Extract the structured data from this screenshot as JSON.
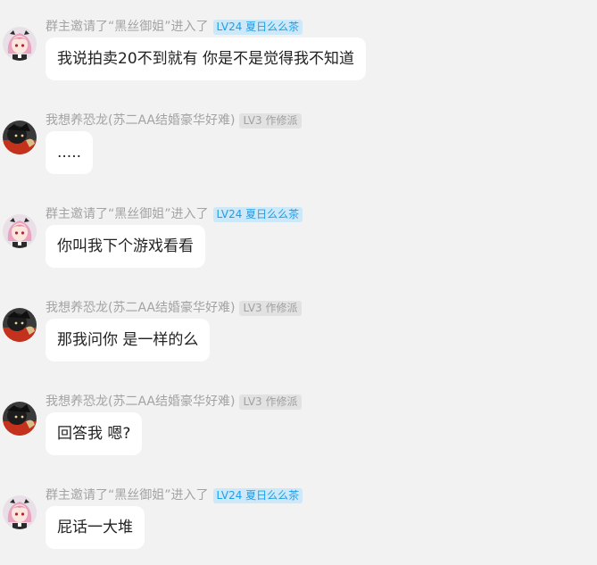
{
  "messages": [
    {
      "sender": "群主邀请了“黑丝御姐”进入了",
      "badge": "LV24 夏日么么茶",
      "badge_style": "blue",
      "avatar": "anime-girl-avatar",
      "text": "我说拍卖20不到就有 你是不是觉得我不知道"
    },
    {
      "sender": "我想养恐龙(苏二AA结婚豪华好难)",
      "badge": "LV3 作修派",
      "badge_style": "gray",
      "avatar": "dark-character-avatar",
      "text": "....."
    },
    {
      "sender": "群主邀请了“黑丝御姐”进入了",
      "badge": "LV24 夏日么么茶",
      "badge_style": "blue",
      "avatar": "anime-girl-avatar",
      "text": "你叫我下个游戏看看"
    },
    {
      "sender": "我想养恐龙(苏二AA结婚豪华好难)",
      "badge": "LV3 作修派",
      "badge_style": "gray",
      "avatar": "dark-character-avatar",
      "text": "那我问你 是一样的么"
    },
    {
      "sender": "我想养恐龙(苏二AA结婚豪华好难)",
      "badge": "LV3 作修派",
      "badge_style": "gray",
      "avatar": "dark-character-avatar",
      "text": "回答我 嗯?"
    },
    {
      "sender": "群主邀请了“黑丝御姐”进入了",
      "badge": "LV24 夏日么么茶",
      "badge_style": "blue",
      "avatar": "anime-girl-avatar",
      "text": "屁话一大堆"
    }
  ],
  "colors": {
    "background": "#f2f2f2",
    "bubble": "#ffffff",
    "sender_text": "#a3a3a3",
    "badge_blue_bg": "#cde8f9",
    "badge_blue_text": "#1e9ee6",
    "badge_gray_bg": "#e2e2e2",
    "badge_gray_text": "#a0a0a0"
  }
}
